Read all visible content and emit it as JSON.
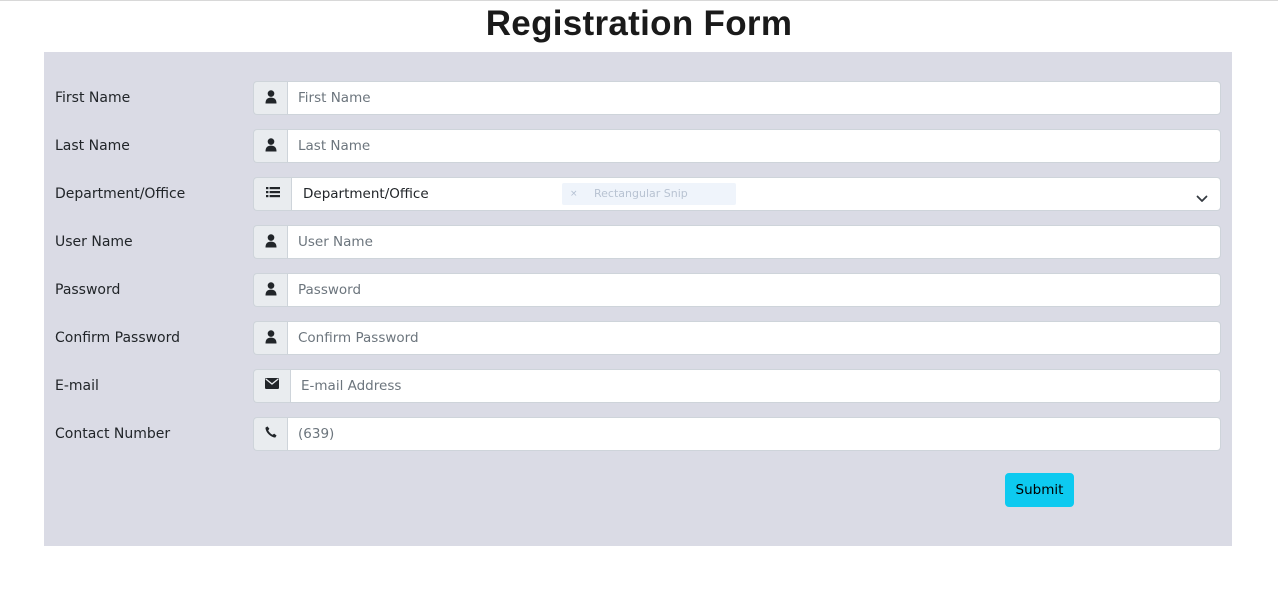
{
  "page": {
    "title": "Registration Form"
  },
  "form": {
    "first_name": {
      "label": "First Name",
      "placeholder": "First Name",
      "value": "",
      "icon": "user-icon"
    },
    "last_name": {
      "label": "Last Name",
      "placeholder": "Last Name",
      "value": "",
      "icon": "user-icon"
    },
    "department": {
      "label": "Department/Office",
      "selected": "Department/Office",
      "icon": "list-icon"
    },
    "user_name": {
      "label": "User Name",
      "placeholder": "User Name",
      "value": "",
      "icon": "user-icon"
    },
    "password": {
      "label": "Password",
      "placeholder": "Password",
      "value": "",
      "icon": "user-icon"
    },
    "confirm_password": {
      "label": "Confirm Password",
      "placeholder": "Confirm Password",
      "value": "",
      "icon": "user-icon"
    },
    "email": {
      "label": "E-mail",
      "placeholder": "E-mail Address",
      "value": "",
      "icon": "envelope-icon"
    },
    "contact": {
      "label": "Contact Number",
      "placeholder": "(639)",
      "value": "",
      "icon": "phone-icon"
    },
    "submit_label": "Submit"
  },
  "overlay": {
    "snip_label": "Rectangular Snip",
    "snip_icon": "×"
  },
  "colors": {
    "panel_bg": "#dadbe5",
    "addon_bg": "#e9ecef",
    "submit_bg": "#0dcaf0",
    "title_color": "#1a1a1a"
  }
}
